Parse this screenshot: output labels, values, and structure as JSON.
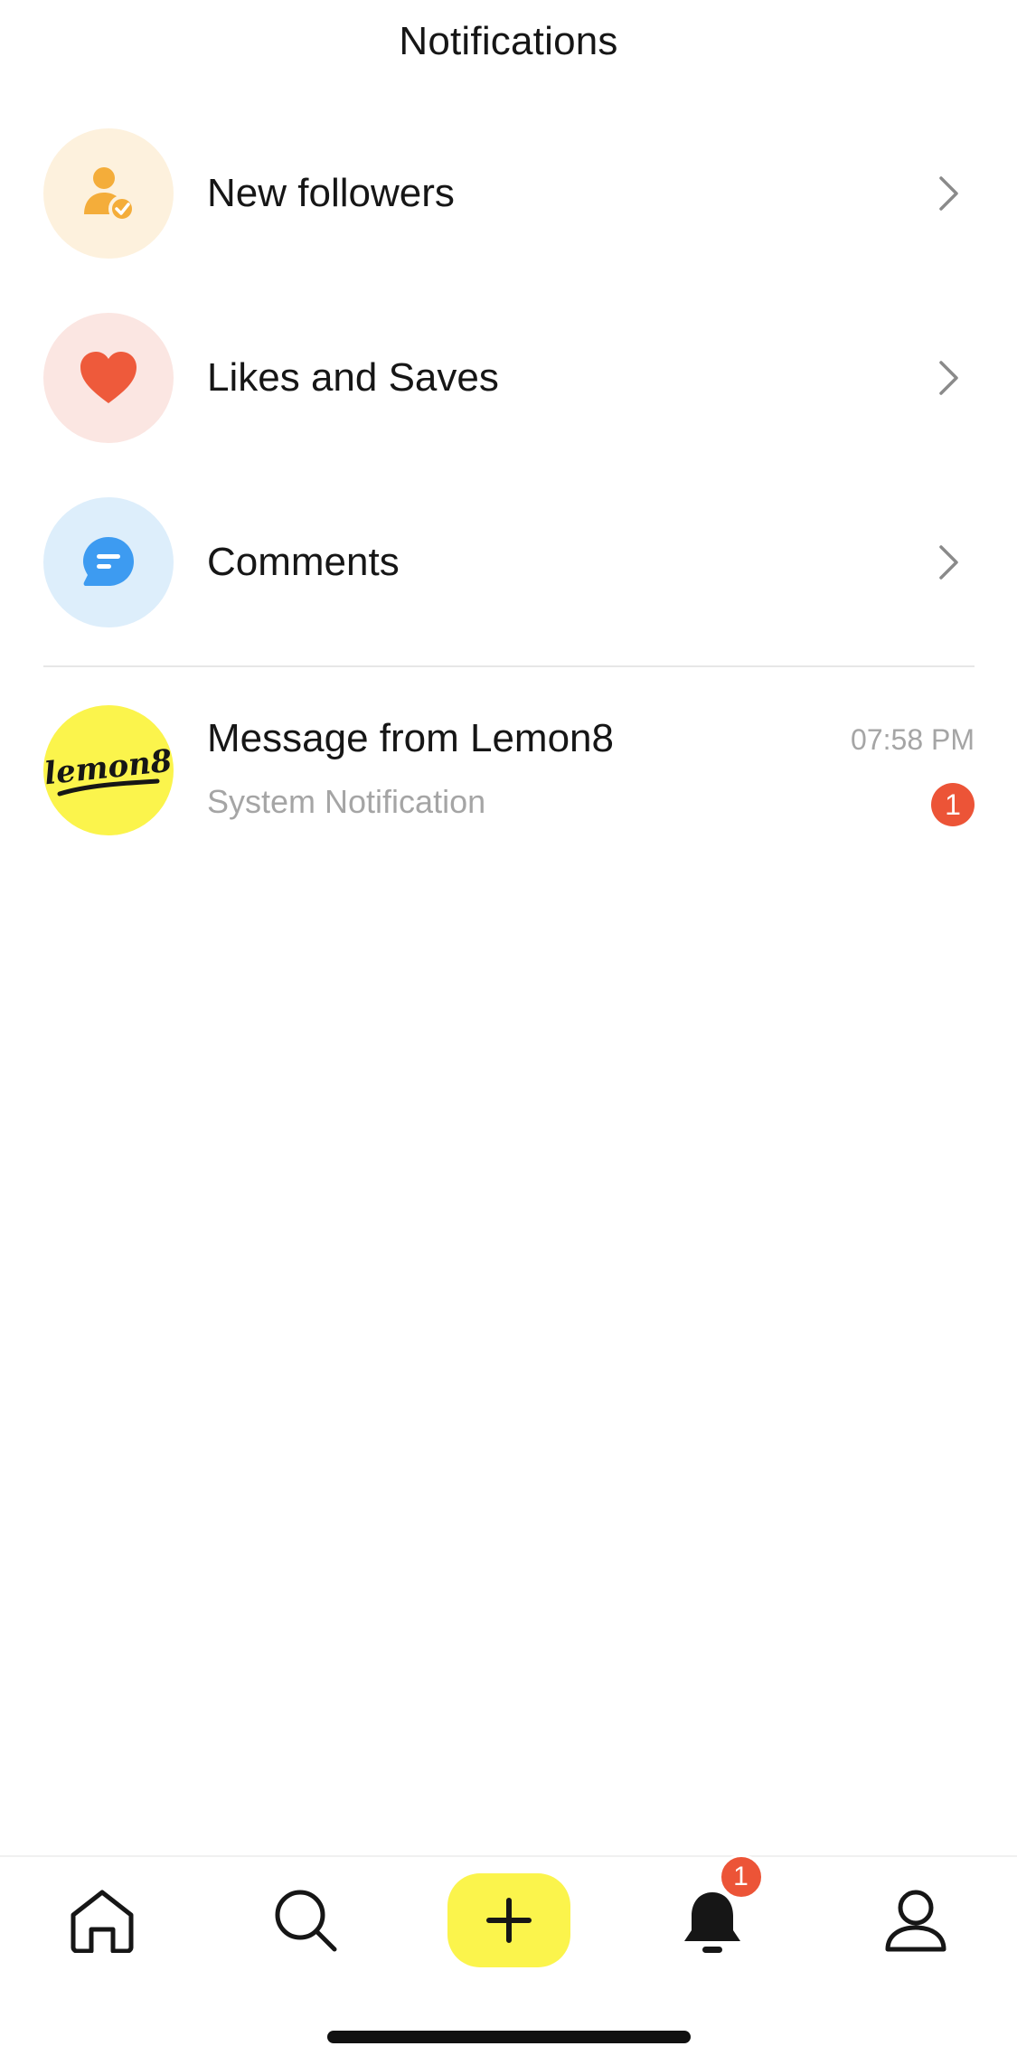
{
  "header": {
    "title": "Notifications"
  },
  "categories": [
    {
      "label": "New followers",
      "icon": "follower-check-icon",
      "bg": "#fdf1dd",
      "accent": "#f4ad3a"
    },
    {
      "label": "Likes and Saves",
      "icon": "heart-icon",
      "bg": "#fbe6e2",
      "accent": "#ee5a3b"
    },
    {
      "label": "Comments",
      "icon": "chat-bubble-icon",
      "bg": "#ddeefb",
      "accent": "#3d9bf1"
    }
  ],
  "message": {
    "avatar_text": "lemon8",
    "title": "Message from Lemon8",
    "subtitle": "System Notification",
    "time": "07:58 PM",
    "unread_count": "1",
    "avatar_bg": "#fbf44c",
    "badge_color": "#ec5437"
  },
  "tabbar": {
    "items": [
      {
        "name": "home",
        "icon": "home-icon"
      },
      {
        "name": "search",
        "icon": "search-icon"
      },
      {
        "name": "create",
        "icon": "plus-icon",
        "bg": "#fbf44c"
      },
      {
        "name": "notifications",
        "icon": "bell-icon",
        "badge": "1"
      },
      {
        "name": "profile",
        "icon": "profile-icon"
      }
    ]
  }
}
